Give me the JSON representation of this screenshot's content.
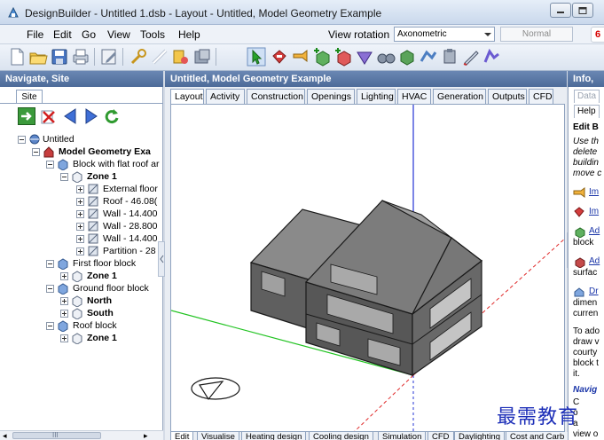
{
  "window": {
    "title": "DesignBuilder - Untitled 1.dsb - Layout - Untitled, Model Geometry Example"
  },
  "menu": {
    "items": [
      "File",
      "Edit",
      "Go",
      "View",
      "Tools",
      "Help"
    ],
    "view_rotation_label": "View rotation",
    "view_rotation_value": "Axonometric",
    "display_mode": "Normal",
    "badge": "6"
  },
  "toolbar": {
    "icons": [
      "new-file-icon",
      "open-folder-icon",
      "save-icon",
      "print-icon",
      "edit-icon",
      "wrench-icon",
      "measure-icon",
      "zoom-icon",
      "image-icon",
      "select-pointer-icon",
      "import-icon",
      "export-icon",
      "add-block-icon",
      "add-outline-icon",
      "add-plane-icon",
      "binoculars-icon",
      "component-icon",
      "transform-icon",
      "stamp-icon",
      "pen-icon",
      "draw-icon"
    ]
  },
  "left_panel": {
    "header": "Navigate, Site",
    "tab": "Site",
    "nav_icons": [
      "go-forward-icon",
      "delete-icon",
      "back-arrow-icon",
      "forward-arrow-icon",
      "refresh-icon"
    ],
    "tree": [
      {
        "label": "Untitled",
        "level": 0,
        "bold": false,
        "icon": "site-icon",
        "expander": "minus"
      },
      {
        "label": "Model Geometry Exa",
        "level": 1,
        "bold": true,
        "icon": "building-icon",
        "expander": "minus"
      },
      {
        "label": "Block with flat roof ar",
        "level": 2,
        "bold": false,
        "icon": "block-icon",
        "expander": "minus"
      },
      {
        "label": "Zone 1",
        "level": 3,
        "bold": true,
        "icon": "zone-icon",
        "expander": "minus"
      },
      {
        "label": "External floor",
        "level": 4,
        "bold": false,
        "icon": "surface-icon",
        "expander": "plus"
      },
      {
        "label": "Roof - 46.08(",
        "level": 4,
        "bold": false,
        "icon": "surface-icon",
        "expander": "plus"
      },
      {
        "label": "Wall - 14.400",
        "level": 4,
        "bold": false,
        "icon": "surface-icon",
        "expander": "plus"
      },
      {
        "label": "Wall - 28.800",
        "level": 4,
        "bold": false,
        "icon": "surface-icon",
        "expander": "plus"
      },
      {
        "label": "Wall - 14.400",
        "level": 4,
        "bold": false,
        "icon": "surface-icon",
        "expander": "plus"
      },
      {
        "label": "Partition - 28",
        "level": 4,
        "bold": false,
        "icon": "surface-icon",
        "expander": "plus"
      },
      {
        "label": "First floor block",
        "level": 2,
        "bold": false,
        "icon": "block-icon",
        "expander": "minus"
      },
      {
        "label": "Zone 1",
        "level": 3,
        "bold": true,
        "icon": "zone-icon",
        "expander": "plus"
      },
      {
        "label": "Ground floor block",
        "level": 2,
        "bold": false,
        "icon": "block-icon",
        "expander": "minus"
      },
      {
        "label": "North",
        "level": 3,
        "bold": true,
        "icon": "zone-icon",
        "expander": "plus"
      },
      {
        "label": "South",
        "level": 3,
        "bold": true,
        "icon": "zone-icon",
        "expander": "plus"
      },
      {
        "label": "Roof block",
        "level": 2,
        "bold": false,
        "icon": "block-icon",
        "expander": "minus"
      },
      {
        "label": "Zone 1",
        "level": 3,
        "bold": true,
        "icon": "zone-icon",
        "expander": "plus"
      }
    ],
    "scroll_thumb_text": "III"
  },
  "center": {
    "header": "Untitled, Model Geometry Example",
    "tabs": [
      "Layout",
      "Activity",
      "Construction",
      "Openings",
      "Lighting",
      "HVAC",
      "Generation",
      "Outputs",
      "CFD"
    ],
    "active_tab": "Layout",
    "bottom_tabs": [
      "Edit",
      "Visualise",
      "Heating design",
      "Cooling design",
      "Simulation",
      "CFD",
      "Daylighting",
      "Cost and Carb"
    ],
    "active_bottom_tab": "Edit"
  },
  "right_panel": {
    "header": "Info,",
    "tabs": [
      "Data",
      "Help"
    ],
    "active_tab": "Help",
    "title": "Edit B",
    "intro": [
      "Use th",
      "delete",
      "buildin",
      "move c"
    ],
    "links": [
      {
        "icon": "import-icon",
        "text": "Im",
        "suffix": ""
      },
      {
        "icon": "export-icon",
        "text": "Im",
        "suffix": ""
      },
      {
        "icon": "add-block-icon",
        "text": "Ad",
        "suffix": "block"
      },
      {
        "icon": "add-surface-icon",
        "text": "Ad",
        "suffix": "surfac"
      },
      {
        "icon": "draw-icon",
        "text": "Dr",
        "suffix": "dimen"
      }
    ],
    "extra_line": "curren",
    "paragraph": [
      "To ado",
      "draw v",
      "courty",
      "block t",
      "it."
    ],
    "navig": "Navig",
    "tail": [
      "C",
      "o",
      "a",
      "view o"
    ]
  },
  "watermark": "最需教育"
}
